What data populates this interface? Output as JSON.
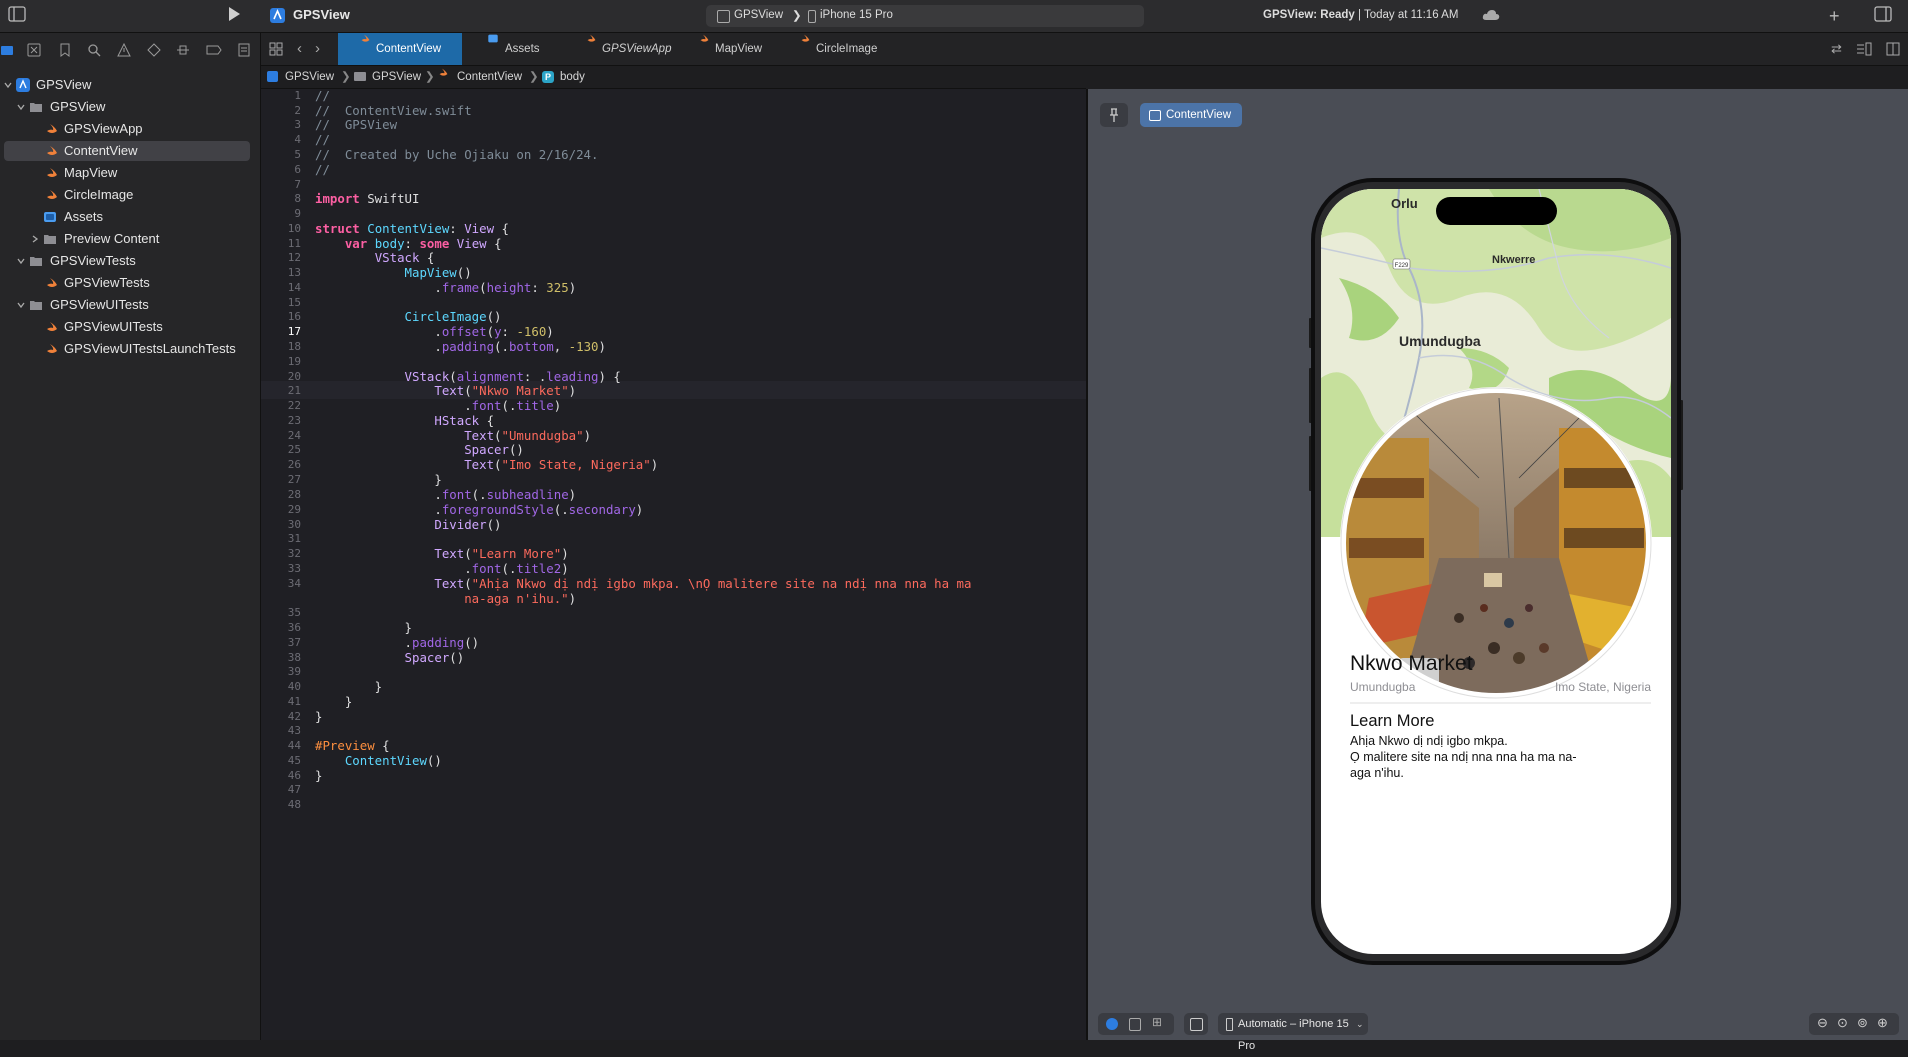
{
  "toolbar": {
    "project_name": "GPSView",
    "scheme_name": "GPSView",
    "destination": "iPhone 15 Pro",
    "status_prefix": "GPSView: Ready",
    "status_time": "Today at 11:16 AM"
  },
  "navigator": {
    "items": [
      {
        "label": "GPSView"
      },
      {
        "label": "GPSView"
      },
      {
        "label": "GPSViewApp"
      },
      {
        "label": "ContentView"
      },
      {
        "label": "MapView"
      },
      {
        "label": "CircleImage"
      },
      {
        "label": "Assets"
      },
      {
        "label": "Preview Content"
      },
      {
        "label": "GPSViewTests"
      },
      {
        "label": "GPSViewTests"
      },
      {
        "label": "GPSViewUITests"
      },
      {
        "label": "GPSViewUITests"
      },
      {
        "label": "GPSViewUITestsLaunchTests"
      }
    ]
  },
  "tabs": [
    {
      "label": "ContentView"
    },
    {
      "label": "Assets"
    },
    {
      "label": "GPSViewApp"
    },
    {
      "label": "MapView"
    },
    {
      "label": "CircleImage"
    }
  ],
  "breadcrumb": [
    "GPSView",
    "GPSView",
    "ContentView",
    "body"
  ],
  "editor": {
    "current_line": 17,
    "line_numbers": [
      "1",
      "2",
      "3",
      "4",
      "5",
      "6",
      "7",
      "8",
      "9",
      "10",
      "11",
      "12",
      "13",
      "14",
      "15",
      "16",
      "17",
      "18",
      "19",
      "20",
      "21",
      "22",
      "23",
      "24",
      "25",
      "26",
      "27",
      "28",
      "29",
      "30",
      "31",
      "32",
      "33",
      "34",
      "35",
      "36",
      "37",
      "38",
      "39",
      "40",
      "41",
      "42",
      "43",
      "44",
      "45",
      "46",
      "47",
      "48"
    ]
  },
  "canvas": {
    "preview_button": "ContentView",
    "device_selector": "Automatic – iPhone 15 Pro",
    "map_labels": {
      "a": "Orlu",
      "b": "Nkwerre",
      "c": "Umundugba",
      "road": "F229"
    },
    "screen": {
      "title": "Nkwo Market",
      "location": "Umundugba",
      "state": "Imo State, Nigeria",
      "subtitle": "Learn More",
      "body_line1": "Ahịa Nkwo dị ndị igbo mkpa.",
      "body_line2": "Ọ malitere site na ndị nna nna ha ma na-",
      "body_line3": "aga n'ihu."
    }
  },
  "colors": {
    "accent": "#1e6aa8",
    "swift": "#f0813a",
    "keyword": "#fc5fa3",
    "string": "#fc6a5d",
    "number": "#d0bf69"
  }
}
